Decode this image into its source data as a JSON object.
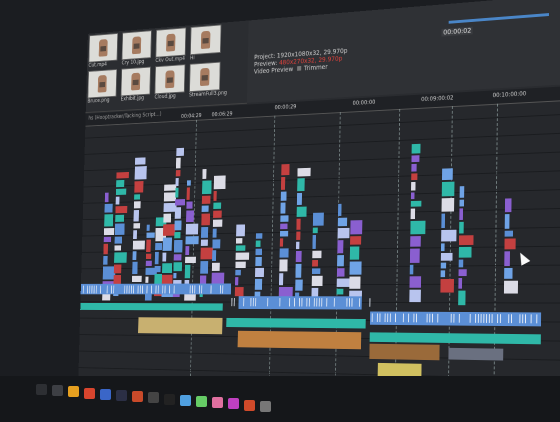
{
  "media": {
    "items": [
      {
        "label": "Ckv Out.mp4"
      },
      {
        "label": "Cut.mp4"
      },
      {
        "label": "Cry 10.jpg"
      },
      {
        "label": "Exhibit.jpg"
      },
      {
        "label": "Cloud.jpg"
      },
      {
        "label": "StreamFull3.png"
      },
      {
        "label": "Bruce.png"
      },
      {
        "label": "Hi"
      }
    ]
  },
  "preview": {
    "project_label": "Project:",
    "project_value": "1920x1080x32, 29.970p",
    "preview_label": "Preview:",
    "preview_value": "480x270x32, 29.970p",
    "video_preview_label": "Video Preview",
    "trimmer_label": "Trimmer"
  },
  "timeline": {
    "url_text": "hs (Hooptracker/Tacking Script...)",
    "ruler_labels": [
      "00:00:29",
      "00:04:29",
      "00:06:29",
      "00:00:00",
      "00:09:00:02",
      "00:10:00:00"
    ],
    "current_time": "00:00:02"
  },
  "colors": {
    "accent": "#4a86c8",
    "clip_blue": "#5b8fd6",
    "clip_purple": "#8a5fd0",
    "clip_teal": "#2fb8a8",
    "clip_red": "#c44040",
    "text_red": "#e0423c"
  },
  "taskbar": {
    "icons": [
      "start-icon",
      "search-icon",
      "folder-icon",
      "chrome-icon",
      "editor-icon",
      "vegas-icon",
      "media-icon",
      "settings-icon",
      "terminal-icon",
      "app-icon",
      "app-icon-2",
      "app-icon-3",
      "app-icon-4",
      "app-icon-5",
      "app-icon-6"
    ]
  }
}
